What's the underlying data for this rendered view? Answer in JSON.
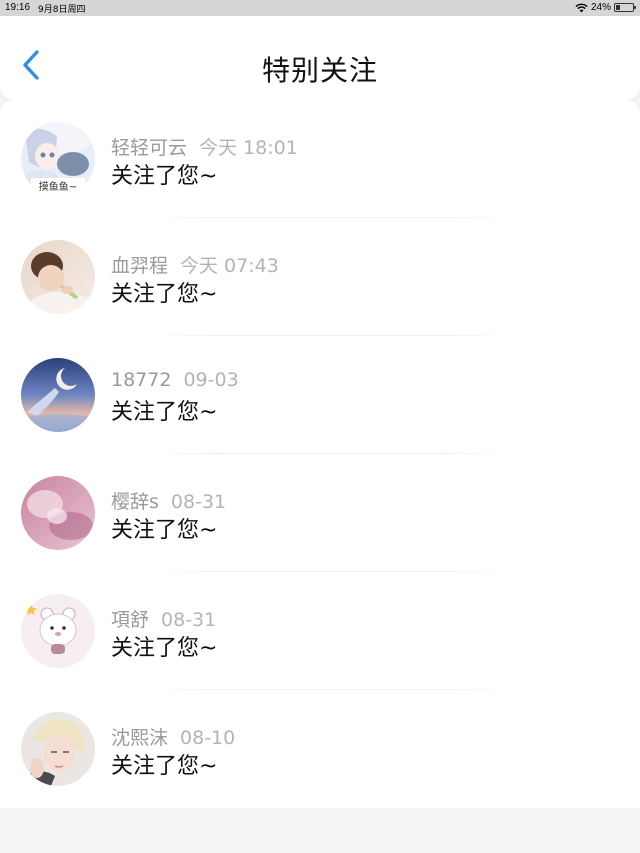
{
  "status_bar": {
    "time": "19:16",
    "date": "9月8日周四",
    "battery": "24%",
    "battery_level": 0.24
  },
  "header": {
    "title": "特别关注",
    "back_icon": "chevron-left-icon",
    "accent_color": "#2f8fe8"
  },
  "items": [
    {
      "name": "轻轻可云",
      "time": "今天 18:01",
      "message": "关注了您~"
    },
    {
      "name": "血羿程",
      "time": "今天 07:43",
      "message": "关注了您~"
    },
    {
      "name": "18772",
      "time": "09-03",
      "message": "关注了您~"
    },
    {
      "name": "樱辞s",
      "time": "08-31",
      "message": "关注了您~"
    },
    {
      "name": "項舒",
      "time": "08-31",
      "message": "关注了您~"
    },
    {
      "name": "沈熙沫",
      "time": "08-10",
      "message": "关注了您~"
    }
  ],
  "avatar_texts": {
    "item0": "摸鱼鱼~"
  }
}
